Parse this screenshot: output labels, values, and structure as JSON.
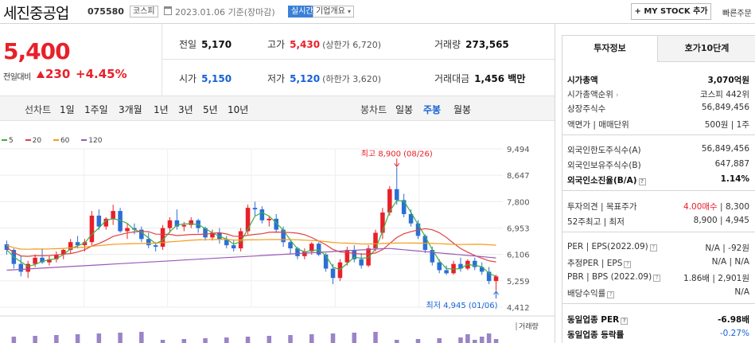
{
  "header": {
    "company": "세진중공업",
    "code": "075580",
    "market": "코스피",
    "date": "2023.01.06 기준(장마감)",
    "live": "실시간",
    "company_info": "기업개요",
    "company_info_chevron": "chevron-down-icon",
    "mystock_label": "MY STOCK 추가",
    "quick_order": "빠른주문"
  },
  "price": {
    "current": "5,400",
    "change_label": "전일대비",
    "change_value": "230",
    "change_pct": "+4.45%",
    "up_color": "#e8202a"
  },
  "stats": {
    "prev_close_label": "전일",
    "prev_close": "5,170",
    "high_label": "고가",
    "high": "5,430",
    "upper_limit": "(상한가 6,720)",
    "volume_label": "거래량",
    "volume": "273,565",
    "open_label": "시가",
    "open": "5,150",
    "low_label": "저가",
    "low": "5,120",
    "lower_limit": "(하한가 3,620)",
    "amount_label": "거래대금",
    "amount": "1,456 백만"
  },
  "rangebar": {
    "line_chart_label": "선차트",
    "ranges": [
      "1일",
      "1주일",
      "3개월",
      "1년",
      "3년",
      "5년",
      "10년"
    ],
    "candle_label": "봉차트",
    "candle_options": [
      "일봉",
      "주봉",
      "월봉"
    ],
    "candle_selected": "주봉"
  },
  "chart_data": {
    "type": "candlestick",
    "period": "weekly",
    "yticks": [
      9494,
      8647,
      7800,
      6953,
      6106,
      5259,
      4412
    ],
    "ylim": [
      4412,
      9494
    ],
    "legend": [
      {
        "name": "5",
        "color": "#3cb043"
      },
      {
        "name": "20",
        "color": "#e0413f"
      },
      {
        "name": "60",
        "color": "#f59c1a"
      },
      {
        "name": "120",
        "color": "#9b59b6"
      }
    ],
    "annotations": {
      "high": "최고 8,900 (08/26)",
      "low": "최저 4,945 (01/06)"
    },
    "volume_label": "거래량",
    "candles": [
      [
        6430,
        6550,
        6100,
        6250
      ],
      [
        6250,
        6300,
        5650,
        5800
      ],
      [
        5800,
        6050,
        5400,
        5550
      ],
      [
        5550,
        5900,
        5350,
        5800
      ],
      [
        5800,
        6100,
        5700,
        6000
      ],
      [
        6000,
        6300,
        5800,
        5850
      ],
      [
        5850,
        6050,
        5750,
        5950
      ],
      [
        5950,
        6200,
        5850,
        6100
      ],
      [
        6100,
        6300,
        5950,
        6250
      ],
      [
        6250,
        6600,
        6150,
        6500
      ],
      [
        6500,
        6700,
        6300,
        6400
      ],
      [
        6400,
        6600,
        6200,
        6500
      ],
      [
        6500,
        7500,
        6400,
        7350
      ],
      [
        7350,
        7550,
        6900,
        7000
      ],
      [
        7000,
        7300,
        6900,
        7250
      ],
      [
        7250,
        7700,
        7050,
        7500
      ],
      [
        7500,
        7600,
        6800,
        6850
      ],
      [
        6850,
        7100,
        6600,
        6950
      ],
      [
        6950,
        7100,
        6750,
        6900
      ],
      [
        6900,
        7000,
        6500,
        6600
      ],
      [
        6600,
        6800,
        6300,
        6400
      ],
      [
        6400,
        6500,
        6200,
        6350
      ],
      [
        6350,
        7050,
        6250,
        6950
      ],
      [
        6950,
        7300,
        6800,
        7200
      ],
      [
        7200,
        7550,
        6900,
        7000
      ],
      [
        7000,
        7150,
        6850,
        7050
      ],
      [
        7050,
        7300,
        6950,
        7200
      ],
      [
        7200,
        7250,
        6800,
        6950
      ],
      [
        6950,
        7000,
        6550,
        6650
      ],
      [
        6650,
        6900,
        6550,
        6800
      ],
      [
        6800,
        6950,
        6450,
        6600
      ],
      [
        6600,
        6700,
        6300,
        6400
      ],
      [
        6400,
        6550,
        6200,
        6300
      ],
      [
        6300,
        6950,
        6200,
        6850
      ],
      [
        6850,
        7700,
        6750,
        7600
      ],
      [
        7600,
        7800,
        7350,
        7550
      ],
      [
        7550,
        7650,
        7100,
        7200
      ],
      [
        7200,
        7350,
        7000,
        7250
      ],
      [
        7250,
        7400,
        6800,
        6900
      ],
      [
        6900,
        7000,
        6350,
        6500
      ],
      [
        6500,
        6600,
        6100,
        6300
      ],
      [
        6300,
        6350,
        5950,
        6050
      ],
      [
        6050,
        6300,
        5950,
        6200
      ],
      [
        6200,
        6500,
        6100,
        6450
      ],
      [
        6450,
        6500,
        6050,
        6100
      ],
      [
        6100,
        6150,
        5550,
        5650
      ],
      [
        5650,
        5800,
        5150,
        5350
      ],
      [
        5350,
        5950,
        5250,
        5850
      ],
      [
        5850,
        6350,
        5750,
        6250
      ],
      [
        6250,
        6400,
        5850,
        5950
      ],
      [
        5950,
        6150,
        5650,
        5750
      ],
      [
        5750,
        6400,
        5700,
        6300
      ],
      [
        6300,
        6900,
        6200,
        6800
      ],
      [
        6800,
        7600,
        6600,
        7450
      ],
      [
        7450,
        8300,
        7350,
        8200
      ],
      [
        8200,
        8900,
        7700,
        7850
      ],
      [
        7850,
        8050,
        7300,
        7400
      ],
      [
        7400,
        7550,
        7000,
        7100
      ],
      [
        7100,
        7200,
        6600,
        6700
      ],
      [
        6700,
        6750,
        6150,
        6250
      ],
      [
        6250,
        6350,
        5750,
        5850
      ],
      [
        5850,
        5950,
        5500,
        5600
      ],
      [
        5600,
        5750,
        5450,
        5500
      ],
      [
        5500,
        5900,
        5450,
        5800
      ],
      [
        5800,
        6000,
        5550,
        5650
      ],
      [
        5650,
        5950,
        5600,
        5900
      ],
      [
        5900,
        6000,
        5600,
        5700
      ],
      [
        5700,
        5850,
        5450,
        5550
      ],
      [
        5550,
        5700,
        5150,
        5250
      ],
      [
        5250,
        5450,
        4945,
        5400
      ]
    ]
  },
  "panel": {
    "tab_active": "투자정보",
    "tab_other": "호가10단계",
    "rows1": [
      {
        "k": "시가총액",
        "v": "3,070억원",
        "bold": true
      },
      {
        "k": "시가총액순위",
        "v": "코스피 442위"
      },
      {
        "k": "상장주식수",
        "v": "56,849,456"
      },
      {
        "k": "액면가 | 매매단위",
        "v": "500원 | 1주"
      }
    ],
    "rows2": [
      {
        "k": "외국인한도주식수(A)",
        "v": "56,849,456"
      },
      {
        "k": "외국인보유주식수(B)",
        "v": "647,887"
      },
      {
        "k": "외국인소진율(B/A)",
        "v": "1.14%",
        "bold": true
      }
    ],
    "opinion_label": "투자의견 | 목표주가",
    "opinion_value": "4.00매수",
    "target_price": "8,300",
    "week52_label": "52주최고 | 최저",
    "week52_value": "8,900 | 4,945",
    "per_label": "PER | EPS(2022.09)",
    "per_value": "N/A | -92원",
    "est_per_label": "추정PER | EPS",
    "est_per_value": "N/A | N/A",
    "pbr_label": "PBR | BPS (2022.09)",
    "pbr_value": "1.86배 | 2,901원",
    "div_label": "배당수익률",
    "div_value": "N/A",
    "industry_per_label": "동일업종 PER",
    "industry_per_value": "-6.98배",
    "industry_chg_label": "동일업종 등락률",
    "industry_chg_value": "-0.27%"
  }
}
